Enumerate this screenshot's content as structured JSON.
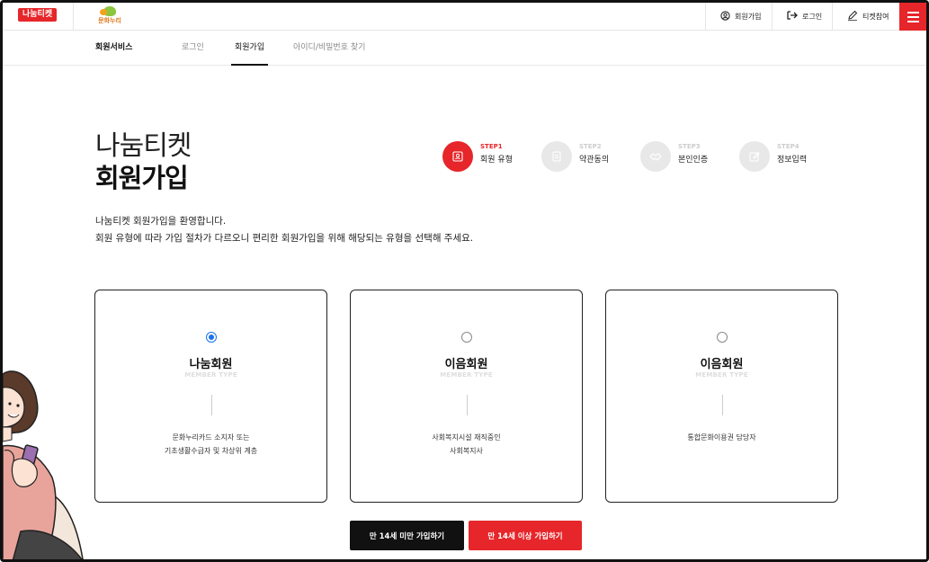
{
  "header": {
    "logo_nanum": "나눔티켓",
    "logo_munhwa": "문화누리",
    "links": [
      {
        "label": "회원가입",
        "icon": "user-circle-icon"
      },
      {
        "label": "로그인",
        "icon": "login-icon"
      },
      {
        "label": "티켓참여",
        "icon": "pencil-icon"
      }
    ],
    "menu_icon": "hamburger-icon",
    "accent_color": "#e6262a"
  },
  "subnav": {
    "section": "회원서비스",
    "items": [
      "로그인",
      "회원가입",
      "아이디/비밀번호 찾기"
    ],
    "active": "회원가입"
  },
  "heading": {
    "line1": "나눔티켓",
    "line2": "회원가입"
  },
  "steps": [
    {
      "num": "STEP1",
      "label": "회원 유형",
      "active": true,
      "icon": "id-card-icon"
    },
    {
      "num": "STEP2",
      "label": "약관동의",
      "active": false,
      "icon": "document-icon"
    },
    {
      "num": "STEP3",
      "label": "본인인증",
      "active": false,
      "icon": "handshake-icon"
    },
    {
      "num": "STEP4",
      "label": "정보입력",
      "active": false,
      "icon": "edit-icon"
    }
  ],
  "welcome": {
    "line1": "나눔티켓 회원가입을 환영합니다.",
    "line2": "회원 유형에 따라 가입 절차가 다르오니 편리한 회원가입을 위해 해당되는 유형을 선택해 주세요."
  },
  "cards": [
    {
      "title": "나눔회원",
      "subtitle": "MEMBER TYPE",
      "desc1": "문화누리카드 소지자 또는",
      "desc2": "기초생활수급자 및 차상위 계층",
      "selected": true
    },
    {
      "title": "이음회원",
      "subtitle": "MEMBER TYPE",
      "desc1": "사회복지시설 재직중인",
      "desc2": "사회복지사",
      "selected": false
    },
    {
      "title": "이음회원",
      "subtitle": "MEMBER TYPE",
      "desc1": "통합문화이용권 담당자",
      "desc2": "",
      "selected": false
    }
  ],
  "buttons": {
    "under14": "만 14세 미만 가입하기",
    "over14": "만 14세 이상 가입하기"
  }
}
